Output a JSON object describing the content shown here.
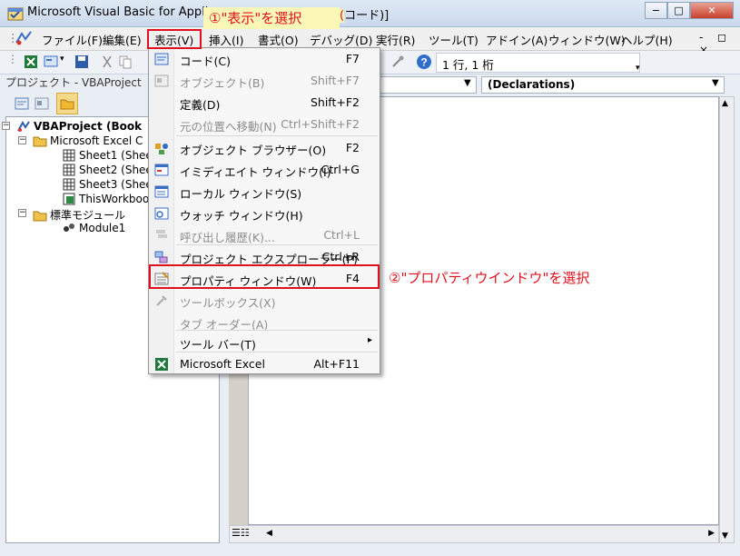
{
  "window": {
    "title": "Microsoft Visual Basic for Applications - Book1 - [Module1 (コード)]",
    "title_visible_left": "Microsoft Visual Basic for Applica",
    "title_visible_right": "コード)]",
    "controls": {
      "minimize": "−",
      "maximize": "□",
      "close": "✕"
    }
  },
  "menubar": {
    "items": [
      "ファイル(F)",
      "編集(E)",
      "表示(V)",
      "挿入(I)",
      "書式(O)",
      "デバッグ(D)",
      "実行(R)",
      "ツール(T)",
      "アドイン(A)",
      "ウィンドウ(W)",
      "ヘルプ(H)"
    ],
    "mdi_controls": "- ◻ ×"
  },
  "toolbar": {
    "position_text": "1 行, 1 桁"
  },
  "project_explorer": {
    "title": "プロジェクト - VBAProject",
    "tree": [
      {
        "label": "VBAProject (Book",
        "level": 0,
        "icon": "vba-project-icon",
        "bold": true
      },
      {
        "label": "Microsoft Excel C",
        "level": 1,
        "icon": "folder-icon"
      },
      {
        "label": "Sheet1 (Sheet",
        "level": 2,
        "icon": "sheet-icon"
      },
      {
        "label": "Sheet2 (Sheet",
        "level": 2,
        "icon": "sheet-icon"
      },
      {
        "label": "Sheet3 (Sheet",
        "level": 2,
        "icon": "sheet-icon"
      },
      {
        "label": "ThisWorkbook",
        "level": 2,
        "icon": "workbook-icon"
      },
      {
        "label": "標準モジュール",
        "level": 1,
        "icon": "folder-icon"
      },
      {
        "label": "Module1",
        "level": 2,
        "icon": "module-icon"
      }
    ]
  },
  "code_window": {
    "object_combo": "",
    "procedure_combo": "(Declarations)"
  },
  "view_menu": {
    "items": [
      {
        "label": "コード(C)",
        "shortcut": "F7",
        "icon": "code-icon",
        "disabled": false
      },
      {
        "label": "オブジェクト(B)",
        "shortcut": "Shift+F7",
        "icon": "object-icon",
        "disabled": true
      },
      {
        "label": "定義(D)",
        "shortcut": "Shift+F2",
        "icon": "",
        "disabled": false
      },
      {
        "label": "元の位置へ移動(N)",
        "shortcut": "Ctrl+Shift+F2",
        "icon": "",
        "disabled": true
      },
      {
        "label": "オブジェクト ブラウザー(O)",
        "shortcut": "F2",
        "icon": "object-browser-icon",
        "disabled": false
      },
      {
        "label": "イミディエイト ウィンドウ(I)",
        "shortcut": "Ctrl+G",
        "icon": "immediate-window-icon",
        "disabled": false
      },
      {
        "label": "ローカル ウィンドウ(S)",
        "shortcut": "",
        "icon": "locals-window-icon",
        "disabled": false
      },
      {
        "label": "ウォッチ ウィンドウ(H)",
        "shortcut": "",
        "icon": "watch-window-icon",
        "disabled": false
      },
      {
        "label": "呼び出し履歴(K)...",
        "shortcut": "Ctrl+L",
        "icon": "call-stack-icon",
        "disabled": true
      },
      {
        "label": "プロジェクト エクスプローラー(P)",
        "shortcut": "Ctrl+R",
        "icon": "project-explorer-icon",
        "disabled": false
      },
      {
        "label": "プロパティ ウィンドウ(W)",
        "shortcut": "F4",
        "icon": "properties-window-icon",
        "disabled": false
      },
      {
        "label": "ツールボックス(X)",
        "shortcut": "",
        "icon": "toolbox-icon",
        "disabled": true
      },
      {
        "label": "タブ オーダー(A)",
        "shortcut": "",
        "icon": "",
        "disabled": true
      },
      {
        "label": "ツール バー(T)",
        "shortcut": "",
        "icon": "",
        "disabled": false,
        "submenu": "▸"
      },
      {
        "label": "Microsoft Excel",
        "shortcut": "Alt+F11",
        "icon": "excel-icon",
        "disabled": false
      }
    ]
  },
  "annotations": {
    "step1": "①\"表示\"を選択",
    "step2": "②\"プロパティウインドウ\"を選択",
    "color": "#e0101e"
  }
}
